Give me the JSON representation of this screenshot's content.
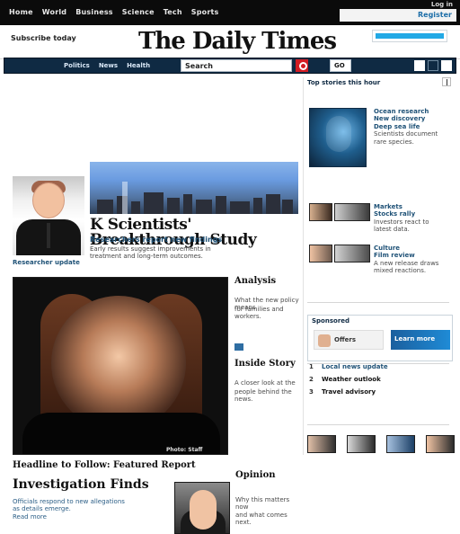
{
  "topbar": {
    "links": [
      "Home",
      "World",
      "Business",
      "Science",
      "Tech",
      "Sports"
    ],
    "right_label": "Register",
    "mini": "Log in"
  },
  "masthead": {
    "tag": "Subscribe today",
    "logo": "The Daily Times",
    "search_placeholder": ""
  },
  "nav": {
    "items": [
      "Politics",
      "News",
      "Health"
    ],
    "search_text": "Search",
    "go_label": "GO"
  },
  "story1": {
    "headline": "K Scientists' Breakthrough Study",
    "subhead": "Researchers report new findings",
    "desc_lines": [
      "Early results suggest improvements in",
      "treatment and long-term outcomes."
    ],
    "caption": "Researcher update"
  },
  "story2": {
    "right_title_1": "Analysis",
    "right_paras_1": [
      "What the new policy means",
      "for families and workers."
    ],
    "right_title_2": "Inside Story",
    "right_paras_2": [
      "A closer look at the",
      "people behind the news."
    ],
    "image_caption": "Photo: Staff"
  },
  "story3": {
    "headline_1": "Headline to Follow: Featured Report",
    "headline_2": "Investigation Finds",
    "lines": [
      "Officials respond to new allegations",
      "as details emerge.",
      "Read more"
    ],
    "side_title": "Opinion",
    "side_paras": [
      "Why this matters now",
      "and what comes next."
    ]
  },
  "rail": {
    "head": "Top stories this hour",
    "item1_lines": [
      "Ocean research",
      "New discovery",
      "Deep sea life"
    ],
    "item1_paras": [
      "Scientists document",
      "rare species."
    ],
    "blurbs_a": [
      "Markets",
      "Stocks rally"
    ],
    "blurbs_a_paras": [
      "Investors react to",
      "latest data."
    ],
    "blurbs_b": [
      "Culture",
      "Film review"
    ],
    "blurbs_b_paras": [
      "A new release draws",
      "mixed reactions."
    ],
    "ad_label": "Sponsored",
    "ad_mini_text": "Offers",
    "ad_blue_text": "Learn more",
    "list": [
      {
        "n": "1",
        "t": "Local news update"
      },
      {
        "n": "2",
        "t": "Weather outlook"
      },
      {
        "n": "3",
        "t": "Travel advisory"
      }
    ]
  },
  "colors": {
    "nav_bg": "#0f2a43",
    "link_blue": "#1f5277",
    "accent_red": "#d21d24",
    "accent_cyan": "#22a9e5"
  },
  "icons": {
    "search": "search-icon",
    "close": "close-icon"
  }
}
